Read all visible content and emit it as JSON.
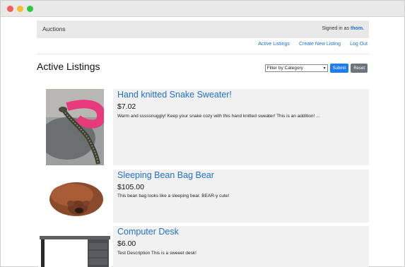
{
  "app": {
    "brand": "Auctions",
    "signed_prefix": "Signed in as",
    "username": "thom."
  },
  "nav": {
    "active": "Active Listings",
    "create": "Create New Listing",
    "logout": "Log Out"
  },
  "page": {
    "title": "Active Listings"
  },
  "filter": {
    "selected": "Filter by Category",
    "submit": "Submit",
    "reset": "Reset"
  },
  "listings": [
    {
      "title": "Hand knitted Snake Sweater!",
      "price": "$7.02",
      "description": "Warm and sssssnuggly! Keep your snake cozy with this hand knitted sweater! This is an addition! ..."
    },
    {
      "title": "Sleeping Bean Bag Bear",
      "price": "$105.00",
      "description": "This bean bag looks like a sleeping bear. BEAR-y cute!"
    },
    {
      "title": "Computer Desk",
      "price": "$6.00",
      "description": "Test Description This is a sweeet desk!"
    }
  ]
}
